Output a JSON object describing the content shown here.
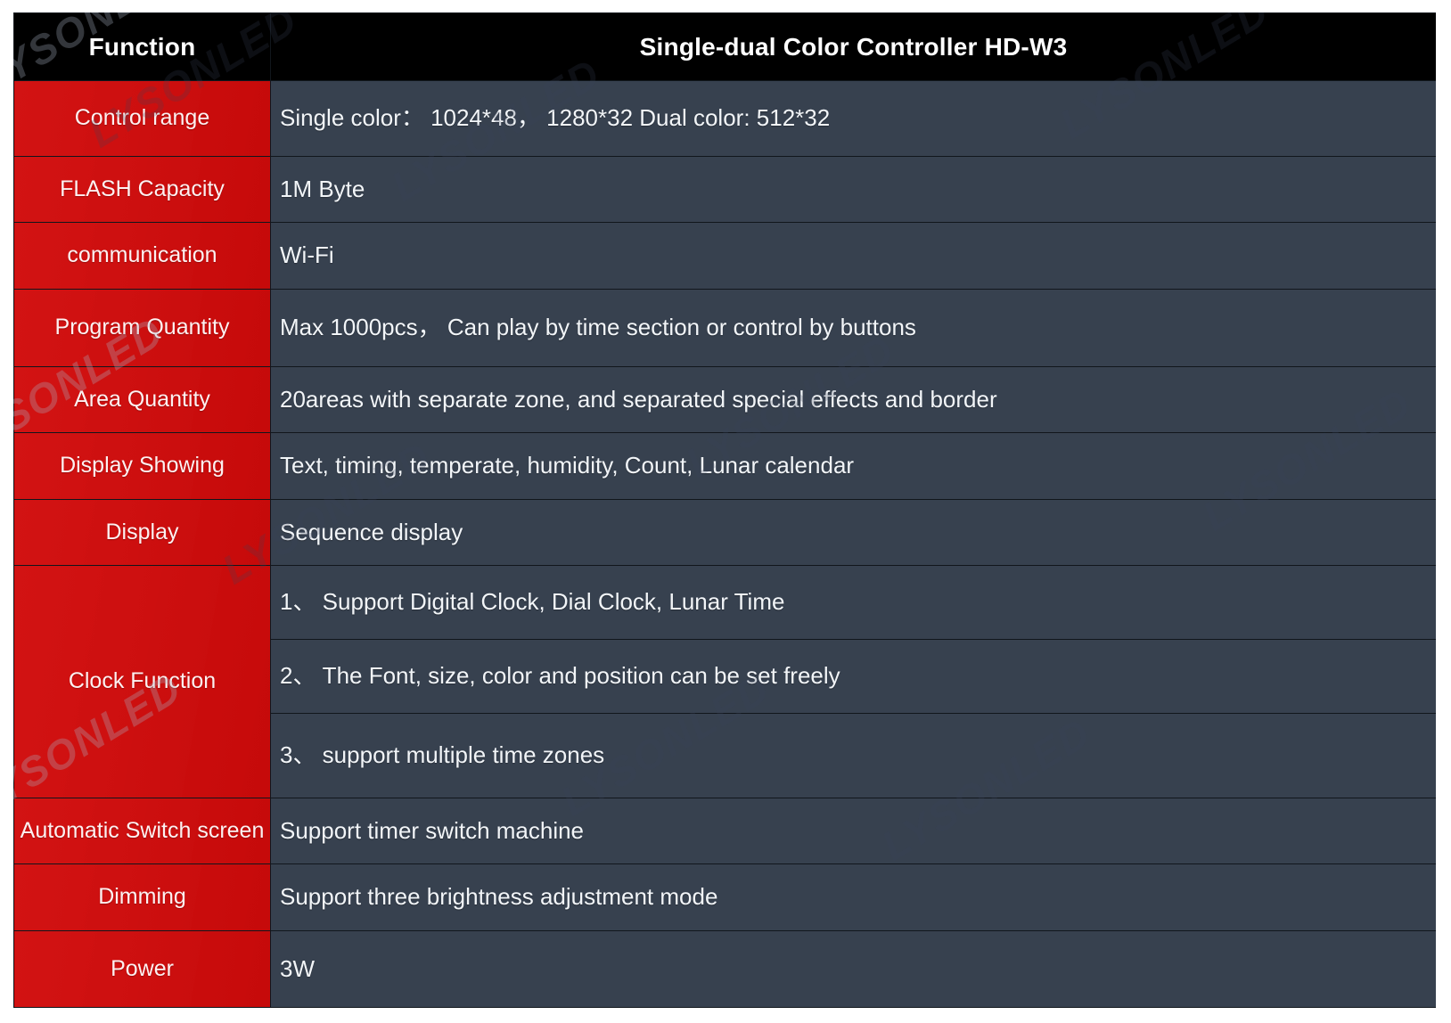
{
  "table": {
    "header": {
      "function_label": "Function",
      "model_title": "Single-dual Color Controller HD-W3"
    },
    "colors": {
      "header_bg": "#000000",
      "label_bg": "#d10b0b",
      "value_bg": "#37414f",
      "text": "#ffffff",
      "border": "#11161c",
      "page_bg": "#ffffff"
    },
    "rows": [
      {
        "label": "Control range",
        "value": "Single color：  1024*48，  1280*32     Dual color: 512*32"
      },
      {
        "label": "FLASH Capacity",
        "value": "1M Byte"
      },
      {
        "label": "communication",
        "value": "Wi-Fi"
      },
      {
        "label": "Program Quantity",
        "value": "Max 1000pcs，  Can play by time section or control by buttons"
      },
      {
        "label": "Area Quantity",
        "value": "20areas with separate zone, and separated special effects and border"
      },
      {
        "label": "Display Showing",
        "value": "Text, timing, temperate, humidity, Count, Lunar calendar"
      },
      {
        "label": "Display",
        "value": "Sequence display"
      },
      {
        "label": "Clock Function",
        "value_1": "1、 Support Digital Clock, Dial Clock, Lunar Time",
        "value_2": "2、 The Font, size, color and position can be set freely",
        "value_3": "3、 support multiple time zones"
      },
      {
        "label": "Automatic Switch screen",
        "value": "Support timer switch machine"
      },
      {
        "label": "Dimming",
        "value": "Support three brightness adjustment mode"
      },
      {
        "label": "Power",
        "value": "3W"
      }
    ]
  },
  "watermark": {
    "text": "LYSONLED"
  }
}
